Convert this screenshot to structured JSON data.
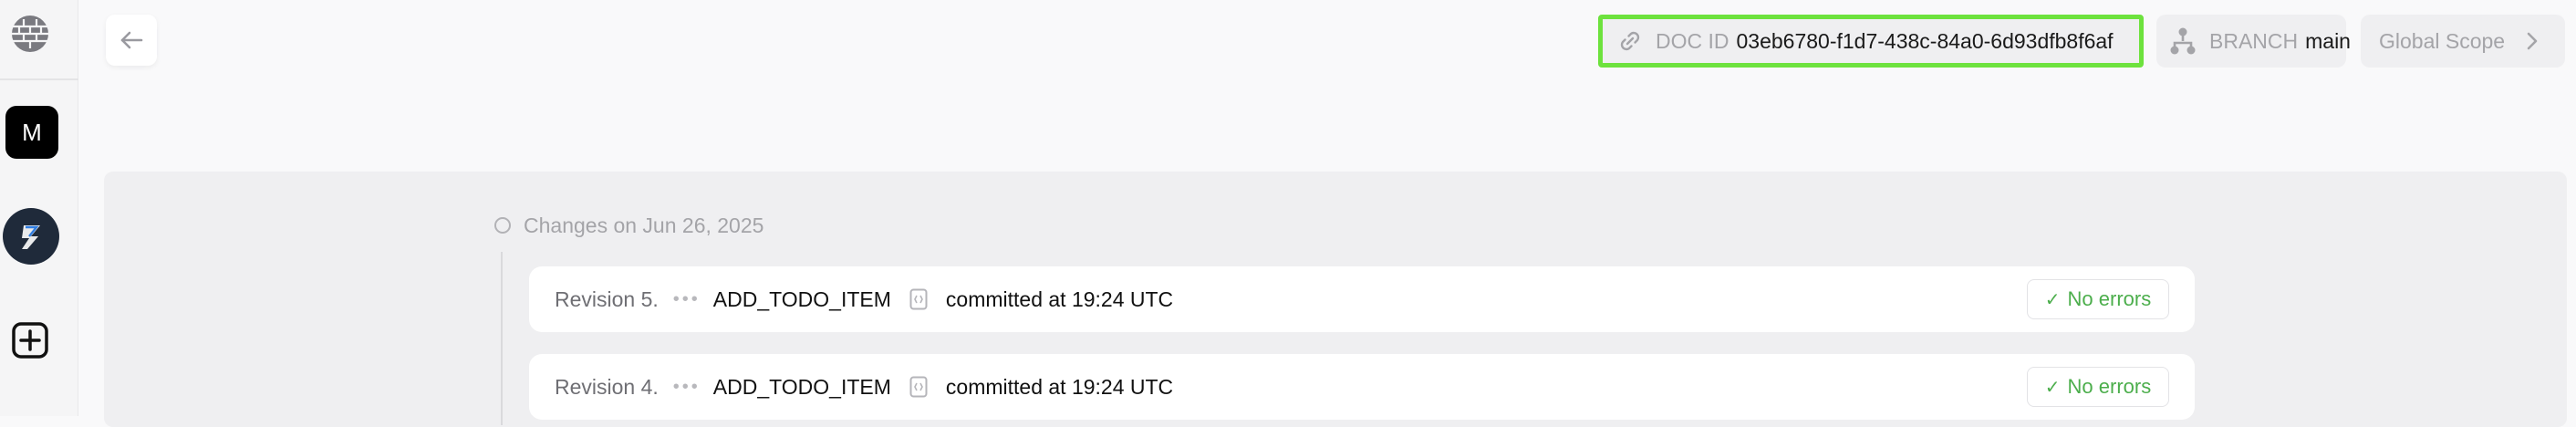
{
  "sidebar": {
    "logo_icon": "brick-globe-icon",
    "apps": [
      {
        "label": "M",
        "icon": "m-app-icon"
      },
      {
        "label": "",
        "icon": "s-app-icon"
      }
    ],
    "add_icon": "plus-square-icon"
  },
  "header": {
    "back_icon": "arrow-left-icon",
    "doc_id": {
      "label": "DOC ID",
      "value": "03eb6780-f1d7-438c-84a0-6d93dfb8f6af",
      "icon": "link-icon"
    },
    "branch": {
      "label": "BRANCH",
      "value": "main",
      "icon": "branch-icon"
    },
    "scope": {
      "label": "Global Scope",
      "icon": "chevron-right-icon"
    }
  },
  "history": {
    "date_label": "Changes on Jun 26, 2025",
    "revisions": [
      {
        "label": "Revision 5.",
        "dots": "•••",
        "action": "ADD_TODO_ITEM",
        "time": "committed at 19:24 UTC",
        "status": "No errors"
      },
      {
        "label": "Revision 4.",
        "dots": "•••",
        "action": "ADD_TODO_ITEM",
        "time": "committed at 19:24 UTC",
        "status": "No errors"
      }
    ]
  },
  "colors": {
    "highlight": "#6de23d",
    "success": "#4cae4c",
    "muted": "#a4a4a8"
  }
}
